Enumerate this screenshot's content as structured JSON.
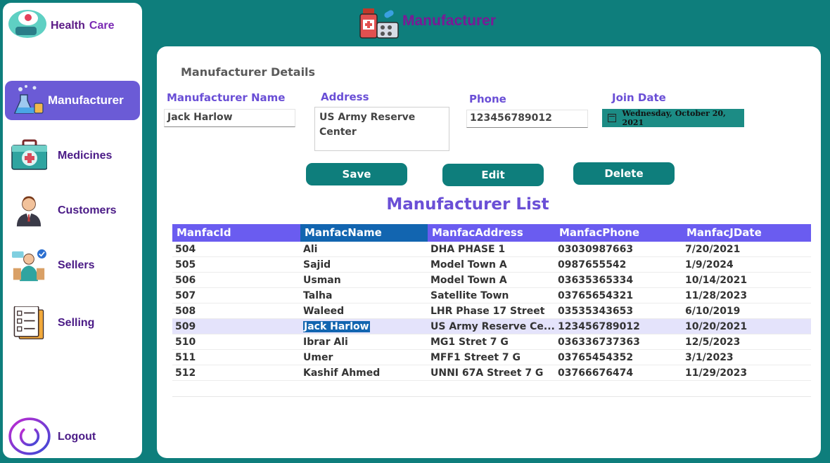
{
  "brand": {
    "word1": "Health",
    "word2": "Care"
  },
  "sidebar": {
    "items": [
      {
        "label": "Manufacturer",
        "icon": "lab-flask-icon",
        "active": true
      },
      {
        "label": "Medicines",
        "icon": "medical-kit-icon",
        "active": false
      },
      {
        "label": "Customers",
        "icon": "customer-icon",
        "active": false
      },
      {
        "label": "Sellers",
        "icon": "seller-icon",
        "active": false
      },
      {
        "label": "Selling",
        "icon": "checklist-icon",
        "active": false
      }
    ],
    "logout_label": "Logout"
  },
  "header": {
    "title": "Manufacturer",
    "icon": "medicine-box-icon"
  },
  "form": {
    "section_title": "Manufacturer Details",
    "name_label": "Manufacturer Name",
    "name_value": "Jack Harlow",
    "address_label": "Address",
    "address_value": "US Army Reserve Center",
    "phone_label": "Phone",
    "phone_value": "123456789012",
    "join_label": "Join Date",
    "join_value": "Wednesday, October 20, 2021"
  },
  "buttons": {
    "save": "Save",
    "edit": "Edit",
    "delete": "Delete"
  },
  "list": {
    "title": "Manufacturer List",
    "columns": [
      "ManfacId",
      "ManfacName",
      "ManfacAddress",
      "ManfacPhone",
      "ManfacJDate"
    ],
    "rows": [
      [
        "504",
        "Ali",
        "DHA PHASE 1",
        "03030987663",
        "7/20/2021"
      ],
      [
        "505",
        "Sajid",
        "Model Town A",
        "0987655542",
        "1/9/2024"
      ],
      [
        "506",
        "Usman",
        "Model Town A",
        "03635365334",
        "10/14/2021"
      ],
      [
        "507",
        "Talha",
        "Satellite Town",
        "03765654321",
        "11/28/2023"
      ],
      [
        "508",
        "Waleed",
        "LHR Phase 17 Street",
        "03535343653",
        "6/10/2019"
      ],
      [
        "509",
        "Jack Harlow",
        "US Army Reserve Ce...",
        "123456789012",
        "10/20/2021"
      ],
      [
        "510",
        "Ibrar Ali",
        "MG1 Stret 7 G",
        "036336737363",
        "12/5/2023"
      ],
      [
        "511",
        "Umer",
        "MFF1 Street 7 G",
        "03765454352",
        "3/1/2023"
      ],
      [
        "512",
        "Kashif Ahmed",
        "UNNI 67A Street 7 G",
        "03766676474",
        "11/29/2023"
      ]
    ]
  },
  "colors": {
    "teal": "#0e7e7c",
    "purple": "#6a4fd6",
    "header_row": "#6a5cf0",
    "selection": "#1265b0"
  }
}
